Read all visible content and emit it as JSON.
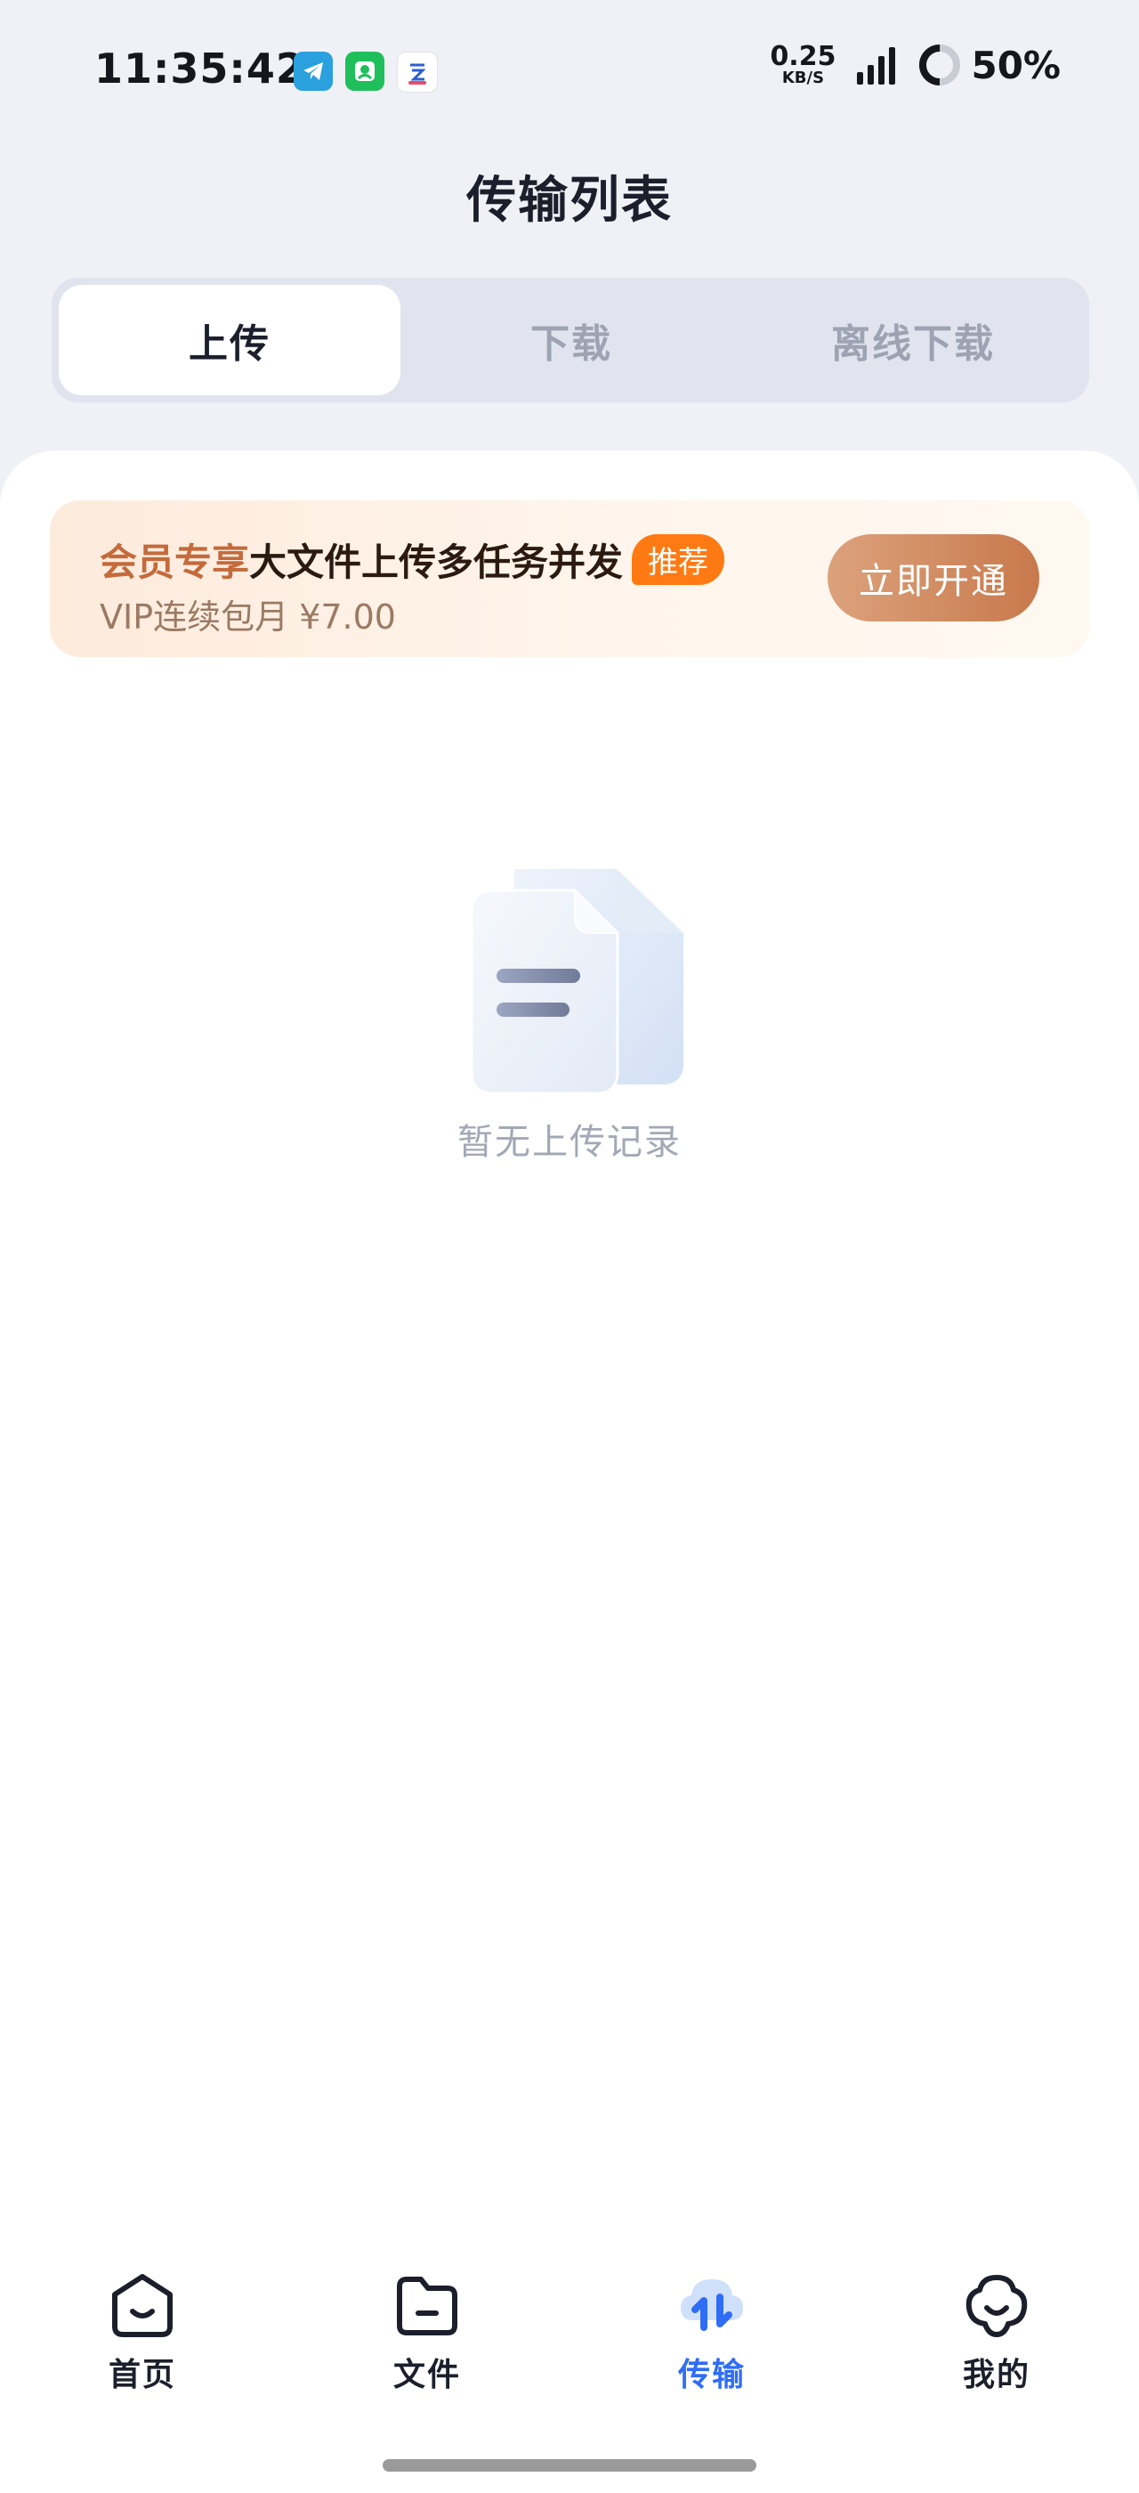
{
  "status_bar": {
    "time": "11:35:42",
    "app_icons": [
      "telegram-icon",
      "green-app-icon",
      "cloud-app-icon"
    ],
    "network_speed": "0.25",
    "network_unit": "KB/S",
    "signal_icon": "signal-bars-icon",
    "battery_percent": "50%",
    "battery_level": 0.5
  },
  "header": {
    "title": "传输列表"
  },
  "tabs": [
    {
      "label": "上传",
      "active": true
    },
    {
      "label": "下载",
      "active": false
    },
    {
      "label": "离线下载",
      "active": false
    }
  ],
  "vip_banner": {
    "highlight": "会员专享",
    "headline": "大文件上传多任务并发",
    "badge": "推荐",
    "subtext": "VIP连续包月 ¥7.00",
    "button_label": "立即开通",
    "colors": {
      "accent": "#c46a3b",
      "badge": "#ff7a12",
      "button": "#d08a5f"
    }
  },
  "empty_state": {
    "icon": "empty-documents-icon",
    "message": "暂无上传记录"
  },
  "bottom_nav": [
    {
      "label": "首页",
      "icon": "home-icon",
      "active": false
    },
    {
      "label": "文件",
      "icon": "folder-icon",
      "active": false
    },
    {
      "label": "传输",
      "icon": "transfer-icon",
      "active": true
    },
    {
      "label": "我的",
      "icon": "profile-icon",
      "active": false
    }
  ],
  "colors": {
    "active_nav": "#2f6df6",
    "background": "#eff1f6"
  }
}
